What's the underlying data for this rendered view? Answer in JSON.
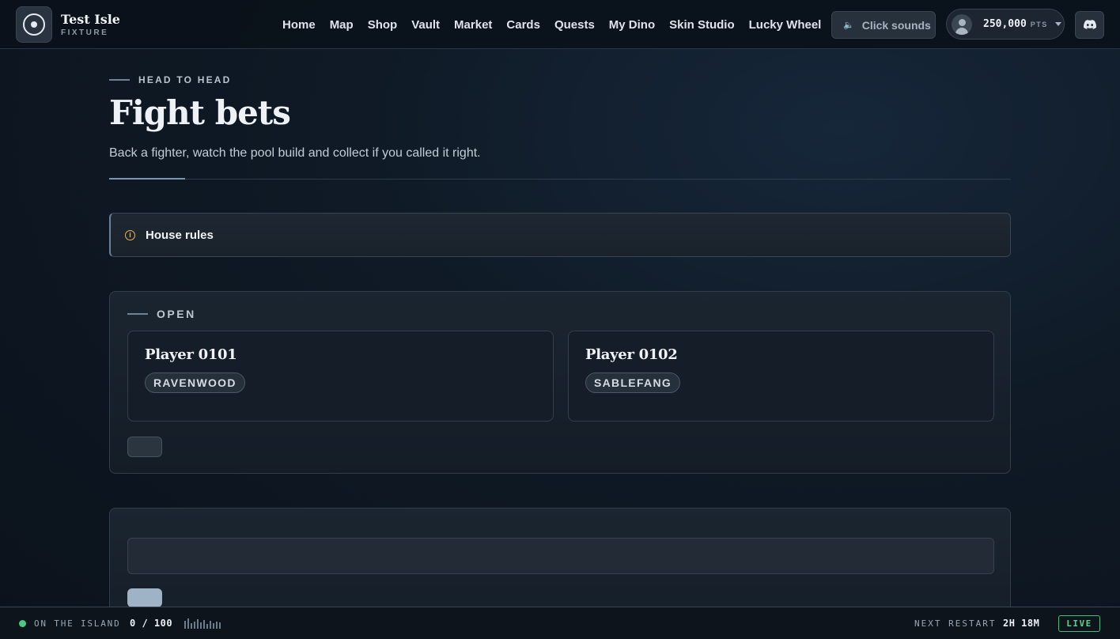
{
  "brand": {
    "name": "Test Isle",
    "subtitle": "FIXTURE"
  },
  "nav": {
    "items": [
      "Home",
      "Map",
      "Shop",
      "Vault",
      "Market",
      "Cards",
      "Quests",
      "My Dino",
      "Skin Studio",
      "Lucky Wheel"
    ]
  },
  "header": {
    "sound_label": "Click sounds",
    "points_value": "250,000",
    "points_unit": "PTS"
  },
  "hero": {
    "eyebrow": "HEAD TO HEAD",
    "title": "Fight bets",
    "subtitle": "Back a fighter, watch the pool build and collect if you called it right."
  },
  "rules": {
    "label": "House rules",
    "icon": "info-icon"
  },
  "open_section": {
    "heading": "OPEN",
    "fighters": [
      {
        "name": "Player 0101",
        "tag": "RAVENWOOD"
      },
      {
        "name": "Player 0102",
        "tag": "SABLEFANG"
      }
    ]
  },
  "footer": {
    "on_island_label": "ON THE ISLAND",
    "on_island_count": "0 / 100",
    "restart_label": "NEXT RESTART",
    "restart_time": "2H 18M",
    "live_label": "LIVE"
  },
  "colors": {
    "accent": "#7d96ad",
    "live_green": "#4fc783",
    "info_amber": "#e2b462"
  }
}
